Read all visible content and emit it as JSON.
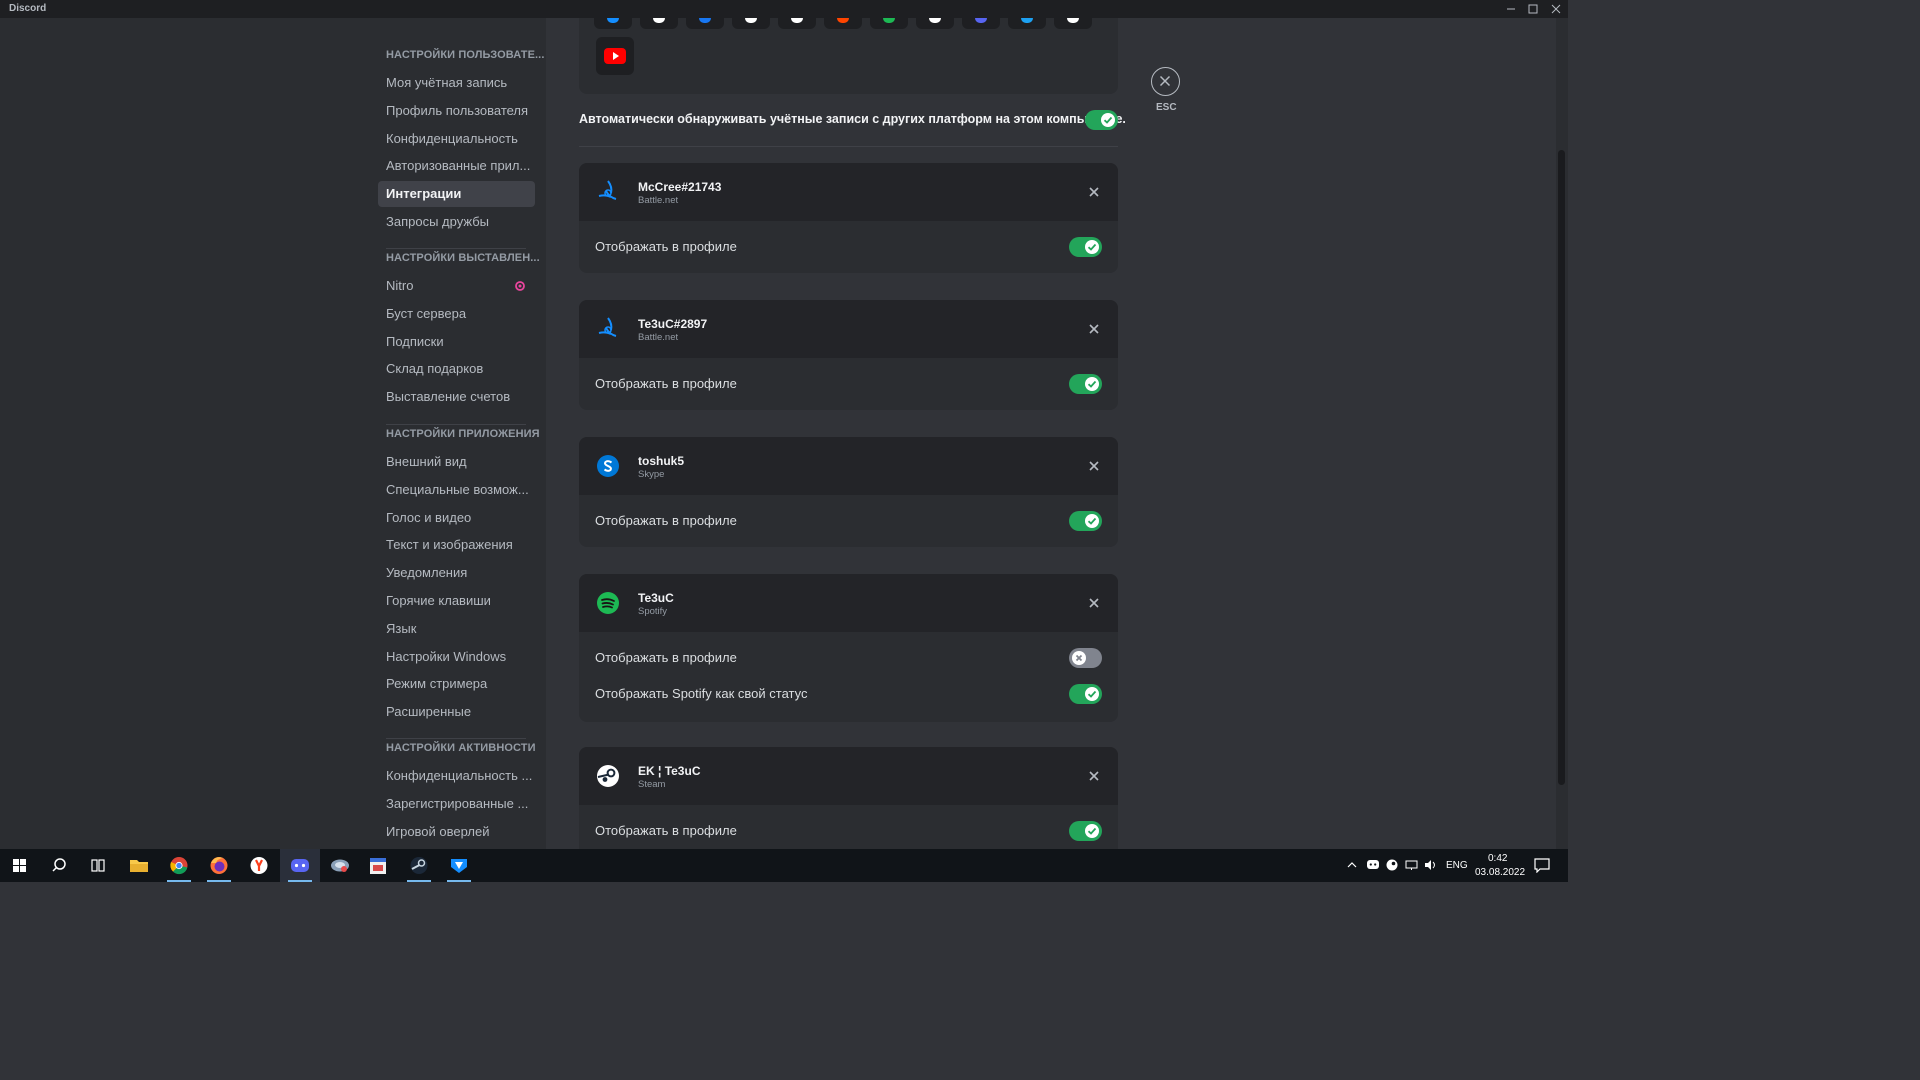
{
  "window": {
    "title": "Discord"
  },
  "sidebar": {
    "sections": [
      {
        "header": "НАСТРОЙКИ ПОЛЬЗОВАТЕ...",
        "items": [
          "Моя учётная запись",
          "Профиль пользователя",
          "Конфиденциальность",
          "Авторизованные прил...",
          "Интеграции",
          "Запросы дружбы"
        ]
      },
      {
        "header": "НАСТРОЙКИ ВЫСТАВЛЕН...",
        "items": [
          "Nitro",
          "Буст сервера",
          "Подписки",
          "Склад подарков",
          "Выставление счетов"
        ]
      },
      {
        "header": "НАСТРОЙКИ ПРИЛОЖЕНИЯ",
        "items": [
          "Внешний вид",
          "Специальные возмож...",
          "Голос и видео",
          "Текст и изображения",
          "Уведомления",
          "Горячие клавиши",
          "Язык",
          "Настройки Windows",
          "Режим стримера",
          "Расширенные"
        ]
      },
      {
        "header": "НАСТРОЙКИ АКТИВНОСТИ",
        "items": [
          "Конфиденциальность ...",
          "Зарегистрированные ...",
          "Игровой оверлей"
        ]
      }
    ],
    "active_item": "Интеграции"
  },
  "content": {
    "auto_detect_label": "Автоматически обнаруживать учётные записи с других платформ на этом компьютере.",
    "auto_detect_enabled": true,
    "platform_icons": [
      "battlenet-icon",
      "tiktok-icon",
      "facebook-icon",
      "github-icon",
      "steam-icon",
      "reddit-icon",
      "spotify-icon",
      "twitch-icon",
      "twitter-icon",
      "xbox-icon",
      "playstation-icon",
      "youtube-icon"
    ],
    "connections": [
      {
        "name": "McCree#21743",
        "platform": "Battle.net",
        "icon": "battlenet-icon",
        "rows": [
          {
            "label": "Отображать в профиле",
            "enabled": true
          }
        ]
      },
      {
        "name": "Te3uC#2897",
        "platform": "Battle.net",
        "icon": "battlenet-icon",
        "rows": [
          {
            "label": "Отображать в профиле",
            "enabled": true
          }
        ]
      },
      {
        "name": "toshuk5",
        "platform": "Skype",
        "icon": "skype-icon",
        "rows": [
          {
            "label": "Отображать в профиле",
            "enabled": true
          }
        ]
      },
      {
        "name": "Te3uC",
        "platform": "Spotify",
        "icon": "spotify-icon",
        "rows": [
          {
            "label": "Отображать в профиле",
            "enabled": false
          },
          {
            "label": "Отображать Spotify как свой статус",
            "enabled": true
          }
        ]
      },
      {
        "name": "EK ¦ Te3uC",
        "platform": "Steam",
        "icon": "steam-icon",
        "rows": [
          {
            "label": "Отображать в профиле",
            "enabled": true
          }
        ]
      }
    ],
    "close_label": "ESC"
  },
  "taskbar": {
    "language": "ENG",
    "time": "0:42",
    "date": "03.08.2022"
  },
  "colors": {
    "toggle_on": "#23a55a",
    "toggle_off": "#80848e",
    "accent": "#5865f2"
  }
}
